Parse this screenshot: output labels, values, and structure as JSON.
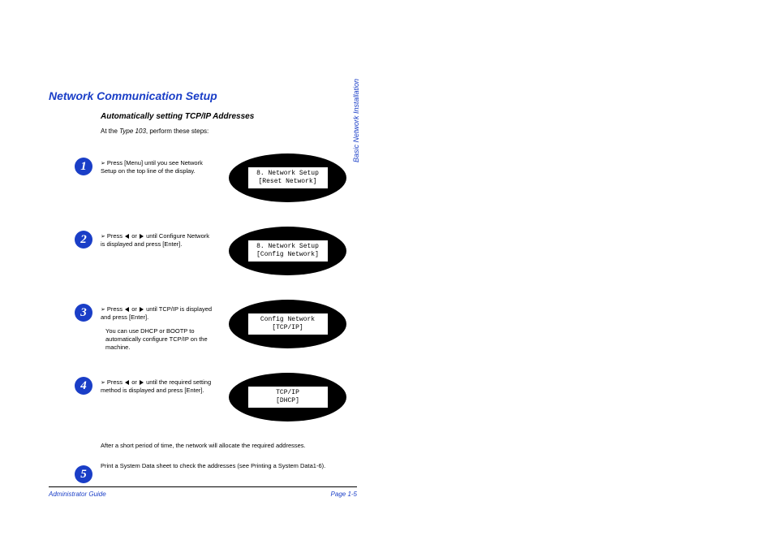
{
  "section_title": "Network Communication Setup",
  "subsection_title": "Automatically setting TCP/IP Addresses",
  "intro_prefix": "At the ",
  "intro_model": "Type 103",
  "intro_suffix": ", perform these steps:",
  "side_label": "Basic Network Installation",
  "steps": [
    {
      "num": "1",
      "text_before": "Press [Menu] until you see Network Setup on the top line of the display.",
      "text_after": "",
      "lcd_line1": "8. Network Setup",
      "lcd_line2": "[Reset Network]"
    },
    {
      "num": "2",
      "text_before": "Press ",
      "text_mid": " or ",
      "text_after": " until Configure Network is displayed and press [Enter].",
      "lcd_line1": "8. Network Setup",
      "lcd_line2": "[Config Network]"
    },
    {
      "num": "3",
      "text_before": "Press ",
      "text_mid": " or ",
      "text_after": " until TCP/IP is displayed and press [Enter].",
      "extra": "You can use DHCP or BOOTP to automatically configure TCP/IP on the machine.",
      "lcd_line1": "Config Network",
      "lcd_line2": "[TCP/IP]"
    },
    {
      "num": "4",
      "text_before": "Press ",
      "text_mid": " or ",
      "text_after": " until the required setting method is displayed and press [Enter].",
      "lcd_line1": "TCP/IP",
      "lcd_line2": "[DHCP]"
    }
  ],
  "after_note": "After a short period of time, the network will allocate the required addresses.",
  "final_step_num": "5",
  "final_step_text": "Print a System Data sheet to check the addresses (see Printing a System Data1-6).",
  "footer_left": "Administrator Guide",
  "footer_right": "Page 1-5"
}
